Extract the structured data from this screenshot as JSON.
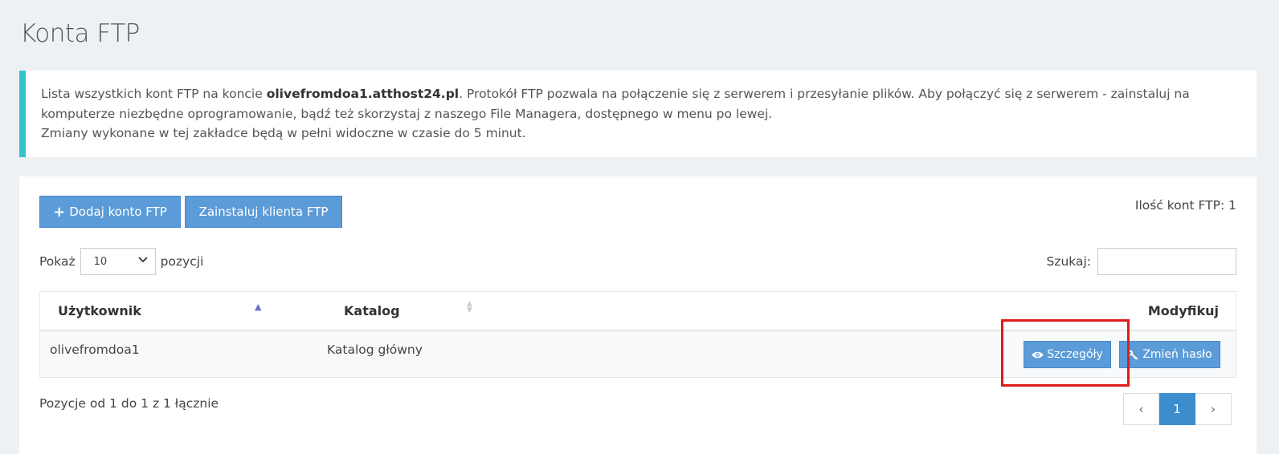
{
  "page": {
    "title": "Konta FTP"
  },
  "info": {
    "text_before": "Lista wszystkich kont FTP na koncie ",
    "account": "olivefromdoa1.atthost24.pl",
    "text_after": ". Protokół FTP pozwala na połączenie się z serwerem i przesyłanie plików. Aby połączyć się z serwerem - zainstaluj na komputerze niezbędne oprogramowanie, bądź też skorzystaj z naszego File Managera, dostępnego w menu po lewej.",
    "line2": "Zmiany wykonane w tej zakładce będą w pełni widoczne w czasie do 5 minut."
  },
  "toolbar": {
    "add_label": "Dodaj konto FTP",
    "install_label": "Zainstaluj klienta FTP",
    "count_label": "Ilość kont FTP: 1"
  },
  "controls": {
    "show_label": "Pokaż",
    "show_value": "10",
    "show_suffix": "pozycji",
    "search_label": "Szukaj:",
    "search_value": ""
  },
  "table": {
    "headers": {
      "user": "Użytkownik",
      "catalog": "Katalog",
      "modify": "Modyfikuj"
    },
    "rows": [
      {
        "user": "olivefromdoa1",
        "catalog": "Katalog główny",
        "details": "Szczegóły",
        "change_password": "Zmień hasło"
      }
    ]
  },
  "footer": {
    "summary": "Pozycje od 1 do 1 z 1 łącznie",
    "prev": "‹",
    "page": "1",
    "next": "›"
  },
  "colors": {
    "accent": "#5b9bd8",
    "info_border": "#32c4cc",
    "highlight": "#e01b1b"
  },
  "icons": {
    "add": "plus-icon",
    "details": "eye-icon",
    "password": "key-icon",
    "select": "chevron-down-icon"
  }
}
